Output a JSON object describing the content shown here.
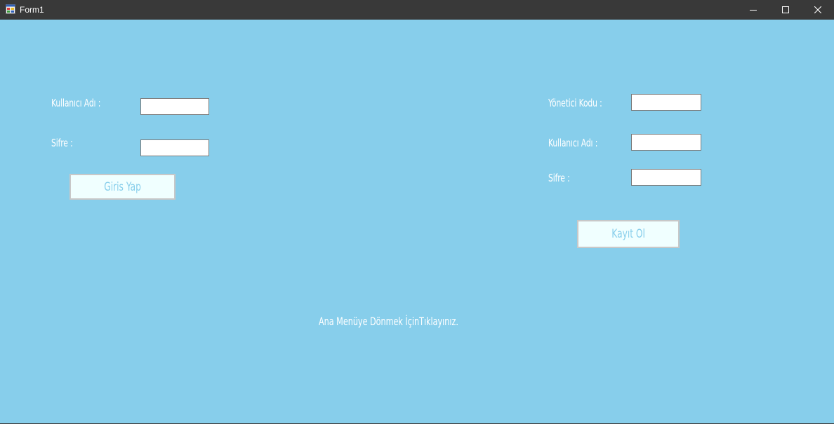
{
  "window": {
    "title": "Form1",
    "controls": {
      "minimize_icon": "minimize-icon",
      "maximize_icon": "maximize-icon",
      "close_icon": "close-icon"
    }
  },
  "colors": {
    "client_background": "#87ceeb",
    "titlebar_background": "#393939",
    "button_background": "#f0ffff",
    "button_text": "#87ceeb",
    "label_text": "#ffffff"
  },
  "login": {
    "username_label": "Kullanıcı Adı :",
    "username_value": "",
    "password_label": "Sifre :",
    "password_value": "",
    "submit_label": "Giris Yap"
  },
  "register": {
    "admin_code_label": "Yönetici Kodu :",
    "admin_code_value": "",
    "username_label": "Kullanıcı Adı :",
    "username_value": "",
    "password_label": "Sifre :",
    "password_value": "",
    "submit_label": "Kayıt Ol"
  },
  "footer": {
    "back_to_menu_text": "Ana Menüye Dönmek İçinTıklayınız."
  }
}
